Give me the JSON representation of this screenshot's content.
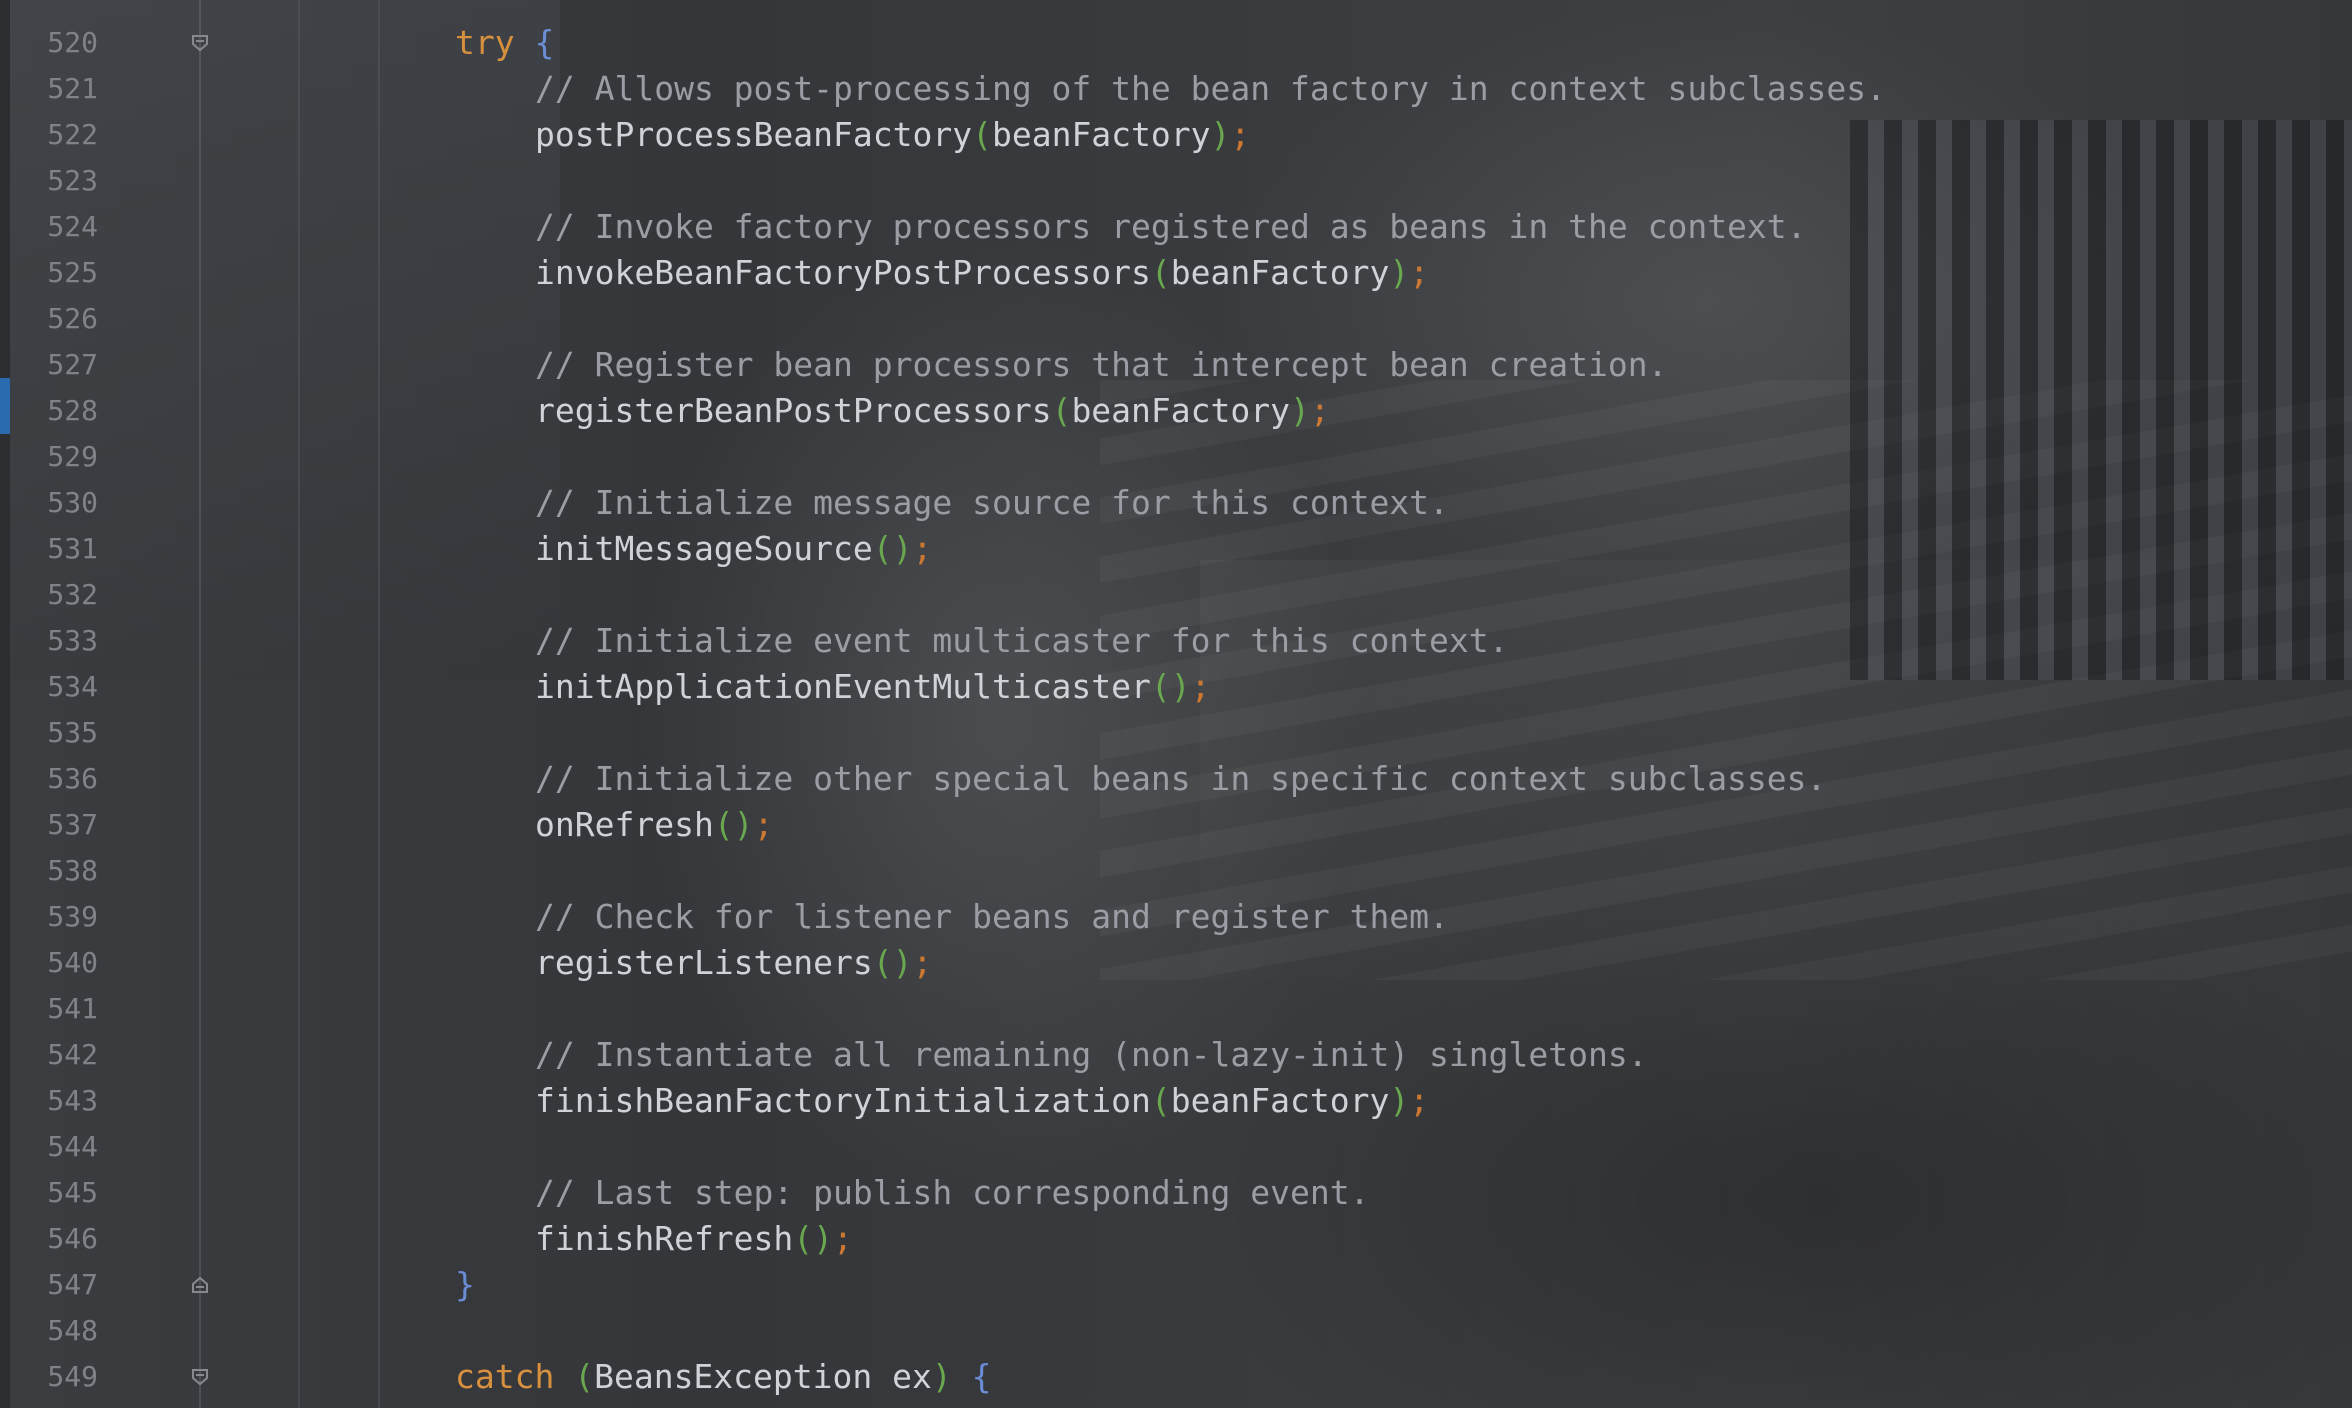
{
  "editor": {
    "lines": [
      {
        "num": "520",
        "indent": 0,
        "parts": [
          [
            "kw",
            "try"
          ],
          [
            "sp",
            " "
          ],
          [
            "brace",
            "{"
          ]
        ]
      },
      {
        "num": "521",
        "indent": 1,
        "parts": [
          [
            "cm",
            "// Allows post-processing of the bean factory in context subclasses."
          ]
        ]
      },
      {
        "num": "522",
        "indent": 1,
        "parts": [
          [
            "fn",
            "postProcessBeanFactory"
          ],
          [
            "paren-g",
            "("
          ],
          [
            "arg",
            "beanFactory"
          ],
          [
            "paren-g",
            ")"
          ],
          [
            "semi",
            ";"
          ]
        ]
      },
      {
        "num": "523",
        "indent": 1,
        "parts": []
      },
      {
        "num": "524",
        "indent": 1,
        "parts": [
          [
            "cm",
            "// Invoke factory processors registered as beans in the context."
          ]
        ]
      },
      {
        "num": "525",
        "indent": 1,
        "parts": [
          [
            "fn",
            "invokeBeanFactoryPostProcessors"
          ],
          [
            "paren-g",
            "("
          ],
          [
            "arg",
            "beanFactory"
          ],
          [
            "paren-g",
            ")"
          ],
          [
            "semi",
            ";"
          ]
        ]
      },
      {
        "num": "526",
        "indent": 1,
        "parts": []
      },
      {
        "num": "527",
        "indent": 1,
        "parts": [
          [
            "cm",
            "// Register bean processors that intercept bean creation."
          ]
        ]
      },
      {
        "num": "528",
        "indent": 1,
        "parts": [
          [
            "fn",
            "registerBeanPostProcessors"
          ],
          [
            "paren-g",
            "("
          ],
          [
            "arg",
            "beanFactory"
          ],
          [
            "paren-g",
            ")"
          ],
          [
            "semi",
            ";"
          ]
        ]
      },
      {
        "num": "529",
        "indent": 1,
        "parts": []
      },
      {
        "num": "530",
        "indent": 1,
        "parts": [
          [
            "cm",
            "// Initialize message source for this context."
          ]
        ]
      },
      {
        "num": "531",
        "indent": 1,
        "parts": [
          [
            "fn",
            "initMessageSource"
          ],
          [
            "paren-g",
            "()"
          ],
          [
            "semi",
            ";"
          ]
        ]
      },
      {
        "num": "532",
        "indent": 1,
        "parts": []
      },
      {
        "num": "533",
        "indent": 1,
        "parts": [
          [
            "cm",
            "// Initialize event multicaster for this context."
          ]
        ]
      },
      {
        "num": "534",
        "indent": 1,
        "parts": [
          [
            "fn",
            "initApplicationEventMulticaster"
          ],
          [
            "paren-g",
            "()"
          ],
          [
            "semi",
            ";"
          ]
        ]
      },
      {
        "num": "535",
        "indent": 1,
        "parts": []
      },
      {
        "num": "536",
        "indent": 1,
        "parts": [
          [
            "cm",
            "// Initialize other special beans in specific context subclasses."
          ]
        ]
      },
      {
        "num": "537",
        "indent": 1,
        "parts": [
          [
            "fn",
            "onRefresh"
          ],
          [
            "paren-g",
            "()"
          ],
          [
            "semi",
            ";"
          ]
        ]
      },
      {
        "num": "538",
        "indent": 1,
        "parts": []
      },
      {
        "num": "539",
        "indent": 1,
        "parts": [
          [
            "cm",
            "// Check for listener beans and register them."
          ]
        ]
      },
      {
        "num": "540",
        "indent": 1,
        "parts": [
          [
            "fn",
            "registerListeners"
          ],
          [
            "paren-g",
            "()"
          ],
          [
            "semi",
            ";"
          ]
        ]
      },
      {
        "num": "541",
        "indent": 1,
        "parts": []
      },
      {
        "num": "542",
        "indent": 1,
        "parts": [
          [
            "cm",
            "// Instantiate all remaining (non-lazy-init) singletons."
          ]
        ]
      },
      {
        "num": "543",
        "indent": 1,
        "parts": [
          [
            "fn",
            "finishBeanFactoryInitialization"
          ],
          [
            "paren-g",
            "("
          ],
          [
            "arg",
            "beanFactory"
          ],
          [
            "paren-g",
            ")"
          ],
          [
            "semi",
            ";"
          ]
        ]
      },
      {
        "num": "544",
        "indent": 1,
        "parts": []
      },
      {
        "num": "545",
        "indent": 1,
        "parts": [
          [
            "cm",
            "// Last step: publish corresponding event."
          ]
        ]
      },
      {
        "num": "546",
        "indent": 1,
        "parts": [
          [
            "fn",
            "finishRefresh"
          ],
          [
            "paren-g",
            "()"
          ],
          [
            "semi",
            ";"
          ]
        ]
      },
      {
        "num": "547",
        "indent": 0,
        "parts": [
          [
            "brace",
            "}"
          ]
        ]
      },
      {
        "num": "548",
        "indent": 0,
        "parts": []
      },
      {
        "num": "549",
        "indent": 0,
        "parts": [
          [
            "kw",
            "catch"
          ],
          [
            "sp",
            " "
          ],
          [
            "paren-g",
            "("
          ],
          [
            "arg",
            "BeansException ex"
          ],
          [
            "paren-g",
            ")"
          ],
          [
            "sp",
            " "
          ],
          [
            "brace",
            "{"
          ]
        ]
      }
    ],
    "fold_markers": [
      "520",
      "547",
      "549"
    ],
    "colors": {
      "keyword": "#d7913e",
      "brace": "#6b8dd6",
      "paren": "#6aa84f",
      "semicolon": "#cc7832",
      "comment": "#9a9ea4",
      "identifier": "#cfd2d6",
      "line_number": "#7f8389",
      "gutter_marker": "#2a6bb0"
    }
  }
}
